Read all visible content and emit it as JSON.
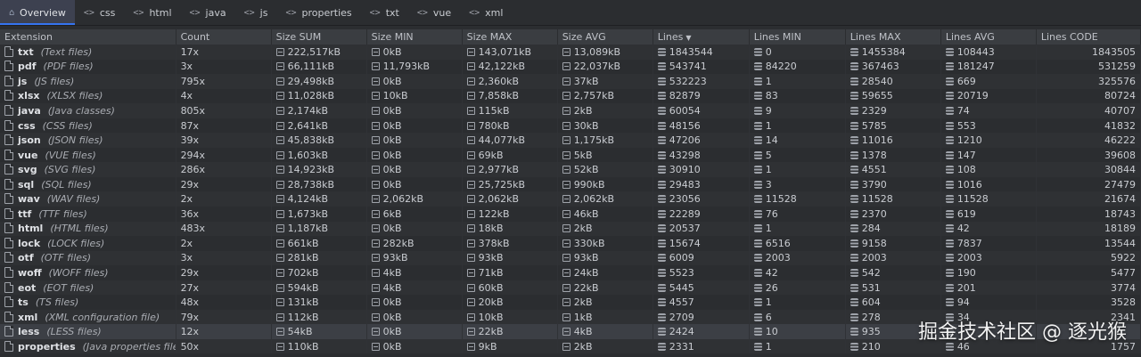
{
  "tabs": [
    {
      "label": "Overview",
      "icon": "home-icon",
      "active": true
    },
    {
      "label": "css",
      "icon": "code-icon"
    },
    {
      "label": "html",
      "icon": "code-icon"
    },
    {
      "label": "java",
      "icon": "code-icon"
    },
    {
      "label": "js",
      "icon": "code-icon"
    },
    {
      "label": "properties",
      "icon": "code-icon"
    },
    {
      "label": "txt",
      "icon": "code-icon"
    },
    {
      "label": "vue",
      "icon": "code-icon"
    },
    {
      "label": "xml",
      "icon": "code-icon"
    }
  ],
  "columns": [
    "Extension",
    "Count",
    "Size SUM",
    "Size MIN",
    "Size MAX",
    "Size AVG",
    "Lines",
    "Lines MIN",
    "Lines MAX",
    "Lines AVG",
    "Lines CODE"
  ],
  "sort": {
    "column": "Lines",
    "direction": "descending"
  },
  "rows": [
    {
      "ext": "txt",
      "desc": "(Text files)",
      "count": "17x",
      "size_sum": "222,517kB",
      "size_min": "0kB",
      "size_max": "143,071kB",
      "size_avg": "13,089kB",
      "lines": "1843544",
      "lines_min": "0",
      "lines_max": "1455384",
      "lines_avg": "108443",
      "lines_code": "1843505"
    },
    {
      "ext": "pdf",
      "desc": "(PDF files)",
      "count": "3x",
      "size_sum": "66,111kB",
      "size_min": "11,793kB",
      "size_max": "42,122kB",
      "size_avg": "22,037kB",
      "lines": "543741",
      "lines_min": "84220",
      "lines_max": "367463",
      "lines_avg": "181247",
      "lines_code": "531259"
    },
    {
      "ext": "js",
      "desc": "(JS files)",
      "count": "795x",
      "size_sum": "29,498kB",
      "size_min": "0kB",
      "size_max": "2,360kB",
      "size_avg": "37kB",
      "lines": "532223",
      "lines_min": "1",
      "lines_max": "28540",
      "lines_avg": "669",
      "lines_code": "325576"
    },
    {
      "ext": "xlsx",
      "desc": "(XLSX files)",
      "count": "4x",
      "size_sum": "11,028kB",
      "size_min": "10kB",
      "size_max": "7,858kB",
      "size_avg": "2,757kB",
      "lines": "82879",
      "lines_min": "83",
      "lines_max": "59655",
      "lines_avg": "20719",
      "lines_code": "80724"
    },
    {
      "ext": "java",
      "desc": "(Java classes)",
      "count": "805x",
      "size_sum": "2,174kB",
      "size_min": "0kB",
      "size_max": "115kB",
      "size_avg": "2kB",
      "lines": "60054",
      "lines_min": "9",
      "lines_max": "2329",
      "lines_avg": "74",
      "lines_code": "40707"
    },
    {
      "ext": "css",
      "desc": "(CSS files)",
      "count": "87x",
      "size_sum": "2,641kB",
      "size_min": "0kB",
      "size_max": "780kB",
      "size_avg": "30kB",
      "lines": "48156",
      "lines_min": "1",
      "lines_max": "5785",
      "lines_avg": "553",
      "lines_code": "41832"
    },
    {
      "ext": "json",
      "desc": "(JSON files)",
      "count": "39x",
      "size_sum": "45,838kB",
      "size_min": "0kB",
      "size_max": "44,077kB",
      "size_avg": "1,175kB",
      "lines": "47206",
      "lines_min": "14",
      "lines_max": "11016",
      "lines_avg": "1210",
      "lines_code": "46222"
    },
    {
      "ext": "vue",
      "desc": "(VUE files)",
      "count": "294x",
      "size_sum": "1,603kB",
      "size_min": "0kB",
      "size_max": "69kB",
      "size_avg": "5kB",
      "lines": "43298",
      "lines_min": "5",
      "lines_max": "1378",
      "lines_avg": "147",
      "lines_code": "39608"
    },
    {
      "ext": "svg",
      "desc": "(SVG files)",
      "count": "286x",
      "size_sum": "14,923kB",
      "size_min": "0kB",
      "size_max": "2,977kB",
      "size_avg": "52kB",
      "lines": "30910",
      "lines_min": "1",
      "lines_max": "4551",
      "lines_avg": "108",
      "lines_code": "30844"
    },
    {
      "ext": "sql",
      "desc": "(SQL files)",
      "count": "29x",
      "size_sum": "28,738kB",
      "size_min": "0kB",
      "size_max": "25,725kB",
      "size_avg": "990kB",
      "lines": "29483",
      "lines_min": "3",
      "lines_max": "3790",
      "lines_avg": "1016",
      "lines_code": "27479"
    },
    {
      "ext": "wav",
      "desc": "(WAV files)",
      "count": "2x",
      "size_sum": "4,124kB",
      "size_min": "2,062kB",
      "size_max": "2,062kB",
      "size_avg": "2,062kB",
      "lines": "23056",
      "lines_min": "11528",
      "lines_max": "11528",
      "lines_avg": "11528",
      "lines_code": "21674"
    },
    {
      "ext": "ttf",
      "desc": "(TTF files)",
      "count": "36x",
      "size_sum": "1,673kB",
      "size_min": "6kB",
      "size_max": "122kB",
      "size_avg": "46kB",
      "lines": "22289",
      "lines_min": "76",
      "lines_max": "2370",
      "lines_avg": "619",
      "lines_code": "18743"
    },
    {
      "ext": "html",
      "desc": "(HTML files)",
      "count": "483x",
      "size_sum": "1,187kB",
      "size_min": "0kB",
      "size_max": "18kB",
      "size_avg": "2kB",
      "lines": "20537",
      "lines_min": "1",
      "lines_max": "284",
      "lines_avg": "42",
      "lines_code": "18189"
    },
    {
      "ext": "lock",
      "desc": "(LOCK files)",
      "count": "2x",
      "size_sum": "661kB",
      "size_min": "282kB",
      "size_max": "378kB",
      "size_avg": "330kB",
      "lines": "15674",
      "lines_min": "6516",
      "lines_max": "9158",
      "lines_avg": "7837",
      "lines_code": "13544"
    },
    {
      "ext": "otf",
      "desc": "(OTF files)",
      "count": "3x",
      "size_sum": "281kB",
      "size_min": "93kB",
      "size_max": "93kB",
      "size_avg": "93kB",
      "lines": "6009",
      "lines_min": "2003",
      "lines_max": "2003",
      "lines_avg": "2003",
      "lines_code": "5922"
    },
    {
      "ext": "woff",
      "desc": "(WOFF files)",
      "count": "29x",
      "size_sum": "702kB",
      "size_min": "4kB",
      "size_max": "71kB",
      "size_avg": "24kB",
      "lines": "5523",
      "lines_min": "42",
      "lines_max": "542",
      "lines_avg": "190",
      "lines_code": "5477"
    },
    {
      "ext": "eot",
      "desc": "(EOT files)",
      "count": "27x",
      "size_sum": "594kB",
      "size_min": "4kB",
      "size_max": "60kB",
      "size_avg": "22kB",
      "lines": "5445",
      "lines_min": "26",
      "lines_max": "531",
      "lines_avg": "201",
      "lines_code": "3774"
    },
    {
      "ext": "ts",
      "desc": "(TS files)",
      "count": "48x",
      "size_sum": "131kB",
      "size_min": "0kB",
      "size_max": "20kB",
      "size_avg": "2kB",
      "lines": "4557",
      "lines_min": "1",
      "lines_max": "604",
      "lines_avg": "94",
      "lines_code": "3528"
    },
    {
      "ext": "xml",
      "desc": "(XML configuration file)",
      "count": "79x",
      "size_sum": "112kB",
      "size_min": "0kB",
      "size_max": "10kB",
      "size_avg": "1kB",
      "lines": "2709",
      "lines_min": "6",
      "lines_max": "278",
      "lines_avg": "34",
      "lines_code": "2341"
    },
    {
      "ext": "less",
      "desc": "(LESS files)",
      "count": "12x",
      "size_sum": "54kB",
      "size_min": "0kB",
      "size_max": "22kB",
      "size_avg": "4kB",
      "lines": "2424",
      "lines_min": "10",
      "lines_max": "935",
      "lines_avg": "",
      "lines_code": "",
      "selected": true
    },
    {
      "ext": "properties",
      "desc": "(Java properties files)",
      "count": "50x",
      "size_sum": "110kB",
      "size_min": "0kB",
      "size_max": "9kB",
      "size_avg": "2kB",
      "lines": "2331",
      "lines_min": "1",
      "lines_max": "210",
      "lines_avg": "46",
      "lines_code": "1757"
    }
  ],
  "watermark": "掘金技术社区 @ 逐光猴",
  "colors": {
    "background": "#2b2d30",
    "header": "#3a3d41",
    "accent": "#3574f0",
    "text": "#c9ccd1"
  }
}
